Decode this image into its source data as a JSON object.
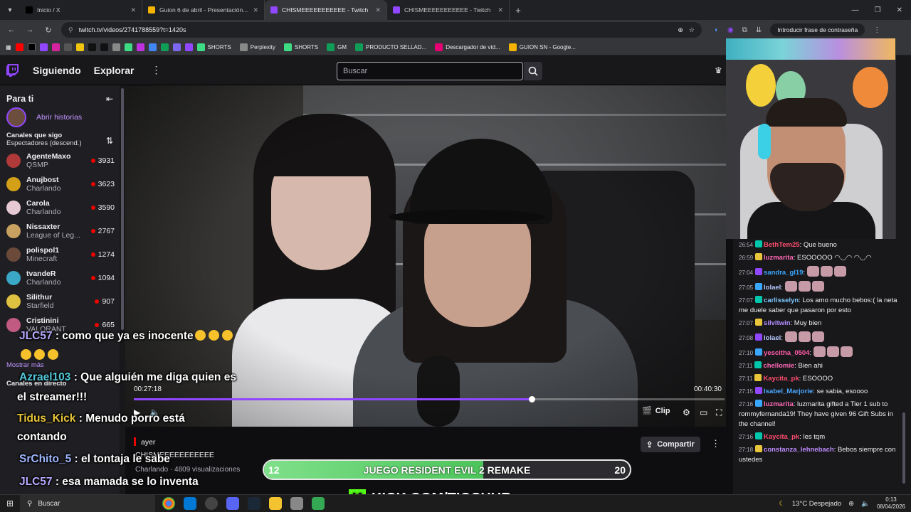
{
  "browser": {
    "tabs": [
      {
        "title": "Inicio / X",
        "fav_color": "#000000",
        "active": false
      },
      {
        "title": "Guion 6 de abril - Presentación...",
        "fav_color": "#f4b400",
        "active": false
      },
      {
        "title": "CHISMEEEEEEEEEEE - Twitch",
        "fav_color": "#9147ff",
        "active": true
      },
      {
        "title": "CHISMEEEEEEEEEEE - Twitch",
        "fav_color": "#9147ff",
        "active": false
      }
    ],
    "new_tab_label": "+",
    "url": "twitch.tv/videos/2741788559?t=1420s",
    "password_prompt": "Introducir frase de contraseña",
    "bookmarks": [
      "SHORTS",
      "Perplexity",
      "SHORTS",
      "GM",
      "PRODUCTO SELLAD...",
      "Descargador de víd...",
      "GUION SN - Google..."
    ]
  },
  "twitch": {
    "nav": {
      "following": "Siguiendo",
      "browse": "Explorar",
      "more": "⋮"
    },
    "search": {
      "placeholder": "Buscar"
    },
    "sidebar": {
      "title": "Para ti",
      "stories_label": "Abrir historias",
      "section_title": "Canales que sigo",
      "section_sub": "Espectadores (descend.)",
      "channels": [
        {
          "name": "AgenteMaxo",
          "game": "QSMP",
          "viewers": "3931",
          "color": "#b03a3a"
        },
        {
          "name": "Anujbost",
          "game": "Charlando",
          "viewers": "3623",
          "color": "#d4a017"
        },
        {
          "name": "Carola",
          "game": "Charlando",
          "viewers": "3590",
          "color": "#e6c9d3"
        },
        {
          "name": "Nissaxter",
          "game": "League of Leg...",
          "viewers": "2767",
          "color": "#c8a060"
        },
        {
          "name": "polispol1",
          "game": "Minecraft",
          "viewers": "1274",
          "color": "#6b4a3a"
        },
        {
          "name": "tvandeR",
          "game": "Charlando",
          "viewers": "1094",
          "color": "#3aa7c7"
        },
        {
          "name": "Silithur",
          "game": "Starfield",
          "viewers": "907",
          "color": "#e0c040"
        },
        {
          "name": "Cristinini",
          "game": "VALORANT",
          "viewers": "665",
          "color": "#c05a80"
        }
      ],
      "show_more": "Mostrar más",
      "live_section": "Canales en directo"
    },
    "video": {
      "time_current": "00:27:18",
      "time_total": "00:40:30",
      "progress": 0.674,
      "clip_label": "Clip"
    },
    "info": {
      "when": "ayer",
      "title": "CHISMEEEEEEEEEEE",
      "meta": "Charlando · 4809 visualizaciones",
      "share_label": "Compartir"
    },
    "chat": [
      {
        "ts": "26:54",
        "user": "BethTem25",
        "color": "#ff4d6d",
        "text": "Que bueno"
      },
      {
        "ts": "26:59",
        "user": "luzmarita",
        "color": "#ff69b4",
        "text": "ESOOOOO ◠◡◠ ◠◡◠"
      },
      {
        "ts": "27:04",
        "user": "sandra_gl19",
        "color": "#3aa7ff",
        "text": ""
      },
      {
        "ts": "27:05",
        "user": "lolael",
        "color": "#b5c9ff",
        "text": ""
      },
      {
        "ts": "27:07",
        "user": "carlisselyn",
        "color": "#7ec8ff",
        "text": "Los amo mucho bebos:( la neta me duele saber que pasaron por esto"
      },
      {
        "ts": "27:07",
        "user": "silvitwin",
        "color": "#b48cff",
        "text": "Muy bien"
      },
      {
        "ts": "27:08",
        "user": "lolael",
        "color": "#b5c9ff",
        "text": ""
      },
      {
        "ts": "27:10",
        "user": "yescitha_0504",
        "color": "#ff5aa8",
        "text": ""
      },
      {
        "ts": "27:11",
        "user": "chellomie",
        "color": "#ff69b4",
        "text": "Bien ahi"
      },
      {
        "ts": "27:11",
        "user": "Kaycita_pk",
        "color": "#ff4d6d",
        "text": "ESOOOO"
      },
      {
        "ts": "27:15",
        "user": "Isabel_Marjorie",
        "color": "#4aa8ff",
        "text": "se sabia, esoooo"
      },
      {
        "ts": "27:16",
        "user": "luzmarita",
        "color": "#ff69b4",
        "text": "luzmarita gifted a Tier 1 sub to rommyfernanda19! They have given 96 Gift Subs in the channel!"
      },
      {
        "ts": "27:16",
        "user": "Kaycita_pk",
        "color": "#ff4d6d",
        "text": "les tqm"
      },
      {
        "ts": "27:18",
        "user": "constanza_lehnebach",
        "color": "#c08cff",
        "text": "Bebos siempre con ustedes"
      }
    ]
  },
  "overlay": {
    "lines": [
      {
        "user": "JLC57",
        "text": " : como que ya es inocente",
        "color": "#b9a8ff"
      },
      {
        "user": "Azrael103",
        "text": " : Que alguién me diga quien es",
        "color": "#52c7d8"
      },
      {
        "user": "",
        "text": "el streamer!!!",
        "color": "#ffffff"
      },
      {
        "user": "Tidus_Kick",
        "text": " : Menudo porro está",
        "color": "#e8c53a"
      },
      {
        "user": "",
        "text": "contando",
        "color": "#ffffff"
      },
      {
        "user": "SrChito_5",
        "text": " : el tontaja le sabe",
        "color": "#9fb6ff"
      },
      {
        "user": "JLC57",
        "text": " : esa mamada se lo inventa",
        "color": "#b9a8ff"
      }
    ],
    "goal_bar": {
      "left": "12",
      "label": "JUEGO RESIDENT EVIL 2 REMAKE",
      "right": "20",
      "progress": 0.6
    },
    "kick_label": "KICK.COM/TIOSHUR"
  },
  "taskbar": {
    "search": "Buscar",
    "weather": "13°C  Despejado",
    "time": "0:13",
    "date": "08/04/2026"
  }
}
